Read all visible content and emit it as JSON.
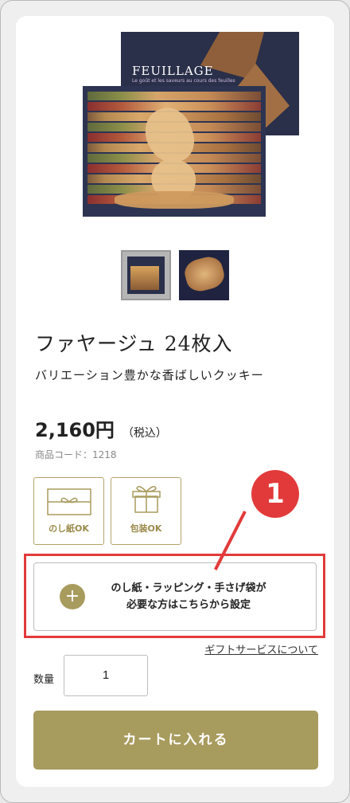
{
  "product": {
    "image_brand": "FEUILLAGE",
    "image_tagline": "Le goût et les saveurs au cours des feuilles",
    "name": "ファヤージュ 24枚入",
    "description": "バリエーション豊かな香ばしいクッキー",
    "price": "2,160円",
    "tax_note": "（税込）",
    "code": "商品コード：1218"
  },
  "badges": [
    {
      "label": "のし紙OK",
      "icon": "noshi-icon"
    },
    {
      "label": "包装OK",
      "icon": "gift-box-icon"
    }
  ],
  "gift_option": {
    "line1": "のし紙・ラッピング・手さげ袋が",
    "line2": "必要な方はこちらから設定",
    "plus": "+"
  },
  "gift_service_link": "ギフトサービスについて",
  "quantity": {
    "label": "数量",
    "value": "1"
  },
  "cart_button": "カートに入れる",
  "annotation": {
    "number": "1",
    "color": "#e23a3a"
  },
  "colors": {
    "accent": "#a89b5e",
    "highlight": "#e23a3a"
  }
}
